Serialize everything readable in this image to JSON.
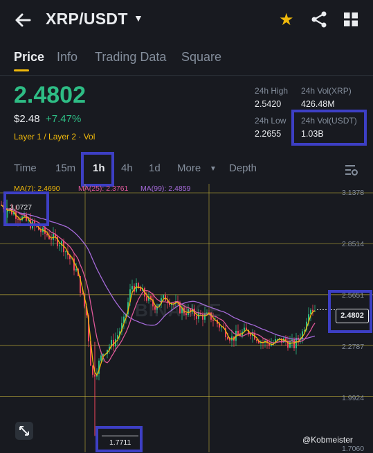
{
  "header": {
    "pair": "XRP/USDT",
    "back_icon": "arrow-left-icon",
    "dropdown_icon": "caret-down-icon",
    "favorite_icon": "star-icon",
    "share_icon": "share-icon",
    "menu_icon": "grid-icon"
  },
  "tabs": [
    {
      "label": "Price"
    },
    {
      "label": "Info"
    },
    {
      "label": "Trading Data"
    },
    {
      "label": "Square"
    }
  ],
  "price": {
    "last": "2.4802",
    "usd": "$2.48",
    "change": "+7.47%",
    "tags": "Layer 1 / Layer 2 · Vol"
  },
  "stats": {
    "high_label": "24h High",
    "high": "2.5420",
    "low_label": "24h Low",
    "low": "2.2655",
    "vol_xrp_label": "24h Vol(XRP)",
    "vol_xrp": "426.48M",
    "vol_usdt_label": "24h Vol(USDT)",
    "vol_usdt": "1.03B"
  },
  "timeframes": {
    "time": "Time",
    "m15": "15m",
    "h1": "1h",
    "h4": "4h",
    "d1": "1d",
    "more": "More",
    "depth": "Depth"
  },
  "ma": {
    "ma7": "MA(7): 2.4690",
    "ma25": "MA(25): 2.3761",
    "ma99": "MA(99): 2.4859"
  },
  "chart": {
    "y_labels": [
      "3.1378",
      "2.8514",
      "2.5651",
      "2.2787",
      "1.9924",
      "1.7060"
    ],
    "high_marker": "3.0727",
    "low_marker": "1.7711",
    "current_price": "2.4802",
    "watermark": "BINANCE",
    "credit": "@Kobmeister",
    "expand_icon": "expand-icon"
  },
  "colors": {
    "up": "#2ebd85",
    "down": "#f6465d",
    "accent": "#f0b90b",
    "highlight_box": "#3d3fc4",
    "ma7": "#f0b90b",
    "ma25": "#e0589a",
    "ma99": "#a56ad9"
  }
}
